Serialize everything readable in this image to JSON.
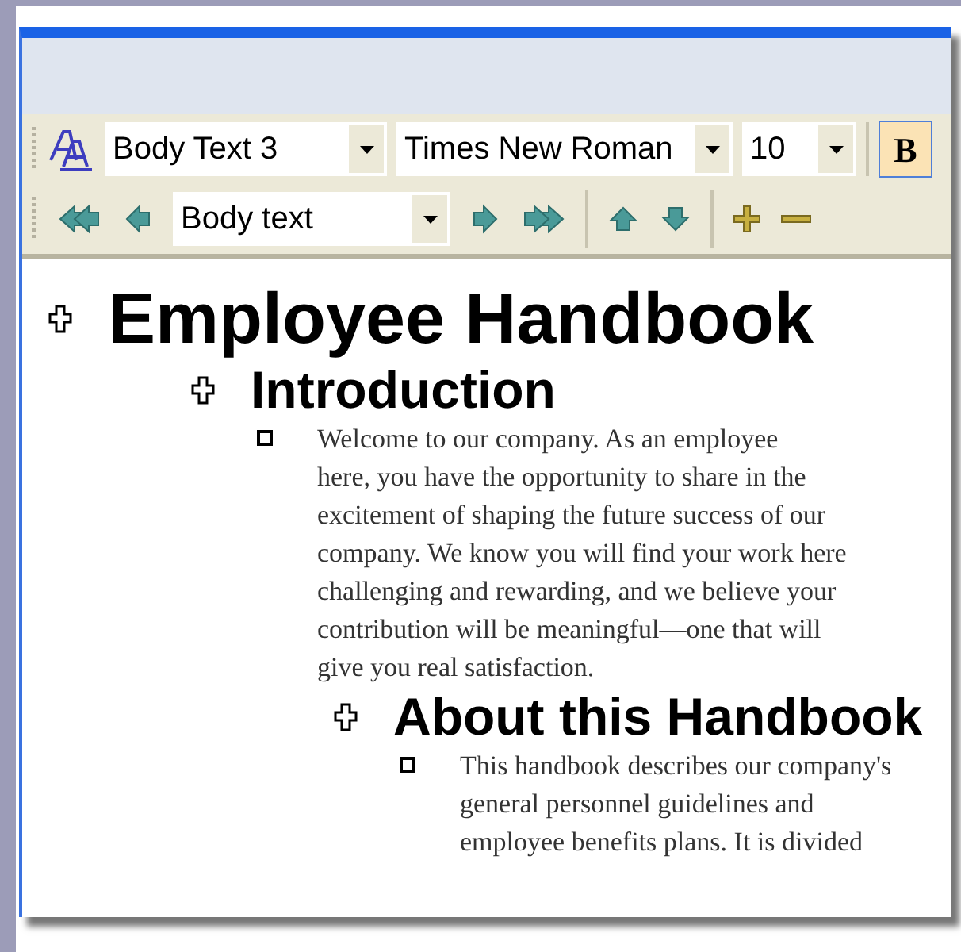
{
  "formatting_toolbar": {
    "style": "Body Text 3",
    "font": "Times New Roman",
    "size": "10",
    "bold": {
      "label": "B",
      "selected": true
    }
  },
  "outlining_toolbar": {
    "level": "Body text"
  },
  "document": {
    "outline": [
      {
        "kind": "heading",
        "text": "Employee Handbook",
        "children": [
          {
            "kind": "heading",
            "text": "Introduction",
            "children": [
              {
                "kind": "body",
                "lines": [
                  "Welcome to our company. As an employee",
                  "here,  you have the opportunity to share in the",
                  "excitement of shaping the future success of our",
                  "company. We know you will find your work here",
                  "challenging and rewarding, and we believe your",
                  "contribution will be meaningful—one that will",
                  "give you real satisfaction."
                ]
              },
              {
                "kind": "heading",
                "text": "About this Handbook",
                "children": [
                  {
                    "kind": "body",
                    "lines": [
                      "This handbook describes our company's",
                      "general personnel guidelines and",
                      "employee benefits plans. It is divided"
                    ]
                  }
                ]
              }
            ]
          }
        ]
      }
    ]
  }
}
